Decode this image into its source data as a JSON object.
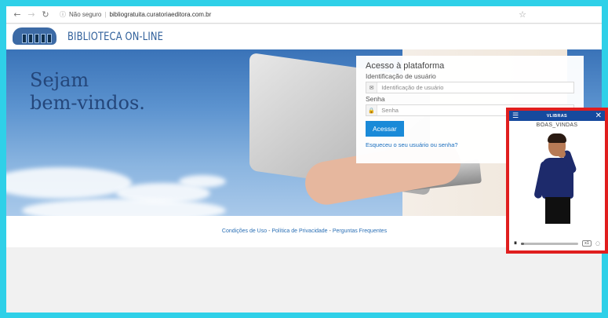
{
  "browser": {
    "url_security": "Não seguro",
    "url": "bibliogratuita.curatoriaeditora.com.br",
    "back_icon": "←",
    "forward_icon": "→",
    "reload_icon": "↻",
    "info_icon": "ⓘ",
    "star_icon": "☆"
  },
  "site": {
    "logo_text": "BIBLIOTECA ON-LINE",
    "welcome_line1": "Sejam",
    "welcome_line2": "bem-vindos."
  },
  "login": {
    "title": "Acesso à plataforma",
    "username_label": "Identificação de usuário",
    "username_placeholder": "Identificação de usuário",
    "password_label": "Senha",
    "password_placeholder": "Senha",
    "user_icon": "✉",
    "lock_icon": "🔒",
    "submit_label": "Acessar",
    "forgot_label": "Esqueceu o seu usuário ou senha?"
  },
  "footer": {
    "terms": "Condições de Uso",
    "privacy": "Política de Privacidade",
    "faq": "Perguntas Frequentes",
    "separator": " - "
  },
  "vlibras": {
    "title": "VLIBRAS",
    "menu_icon": "☰",
    "close_icon": "✕",
    "gloss": "BOAS_VINDAS",
    "pause_icon": "⏸",
    "speed_label": "x1",
    "subtitle_icon": "◌",
    "progress": 0.05
  },
  "colors": {
    "frame": "#2fd0e8",
    "widget_border": "#e01e1e",
    "button": "#1a8ad8",
    "link": "#1a6fbf"
  }
}
